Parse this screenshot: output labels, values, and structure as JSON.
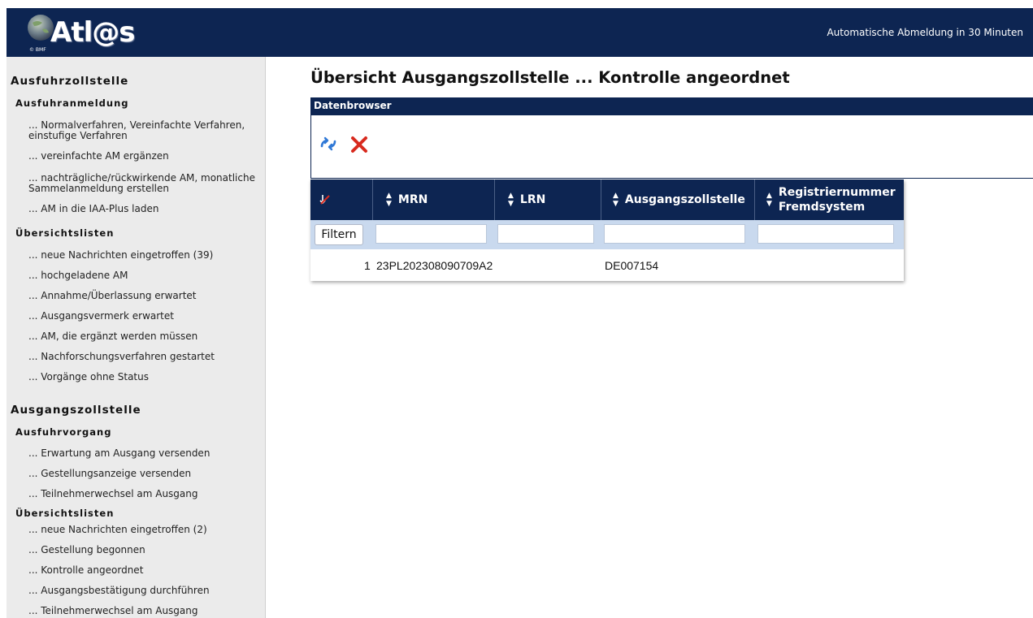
{
  "header": {
    "logo_text": "Atl@s",
    "logo_small": "© BMF",
    "logout_notice": "Automatische Abmeldung in 30 Minuten"
  },
  "sidebar": {
    "sections": [
      {
        "title": "Ausfuhrzollstelle",
        "groups": [
          {
            "title": "Ausfuhranmeldung",
            "items": [
              "... Normalverfahren, Vereinfachte Verfahren, einstufige Verfahren",
              "... vereinfachte AM ergänzen",
              "... nachträgliche/rückwirkende AM, monatliche Sammelanmeldung erstellen",
              "... AM in die IAA-Plus laden"
            ]
          },
          {
            "title": "Übersichtslisten",
            "items": [
              "... neue Nachrichten eingetroffen (39)",
              "... hochgeladene AM",
              "... Annahme/Überlassung erwartet",
              "... Ausgangsvermerk erwartet",
              "... AM, die ergänzt werden müssen",
              "... Nachforschungsverfahren gestartet",
              "... Vorgänge ohne Status"
            ]
          }
        ]
      },
      {
        "title": "Ausgangszollstelle",
        "groups": [
          {
            "title": "Ausfuhrvorgang",
            "items": [
              "... Erwartung am Ausgang versenden",
              "... Gestellungsanzeige versenden",
              "... Teilnehmerwechsel am Ausgang"
            ]
          },
          {
            "title": "Übersichtslisten",
            "items": [
              "... neue Nachrichten eingetroffen (2)",
              "... Gestellung begonnen",
              "... Kontrolle angeordnet",
              "... Ausgangsbestätigung durchführen",
              "... Teilnehmerwechsel am Ausgang"
            ]
          }
        ]
      }
    ]
  },
  "main": {
    "title": "Übersicht Ausgangszollstelle ... Kontrolle angeordnet",
    "browser_title": "Datenbrowser",
    "toolbar": {
      "refresh_icon": "refresh-icon",
      "delete_icon": "delete-icon"
    },
    "grid": {
      "columns": [
        {
          "label": "",
          "icon": "clear-sort-icon"
        },
        {
          "label": "MRN"
        },
        {
          "label": "LRN"
        },
        {
          "label": "Ausgangszollstelle"
        },
        {
          "label": "Registriernummer Fremdsystem"
        }
      ],
      "filter_button": "Filtern",
      "rows": [
        {
          "num": "1",
          "mrn": "23PL202308090709A2",
          "lrn": "",
          "ausgangszollstelle": "DE007154",
          "registriernummer": ""
        }
      ]
    }
  },
  "colors": {
    "header_bg": "#0d2552",
    "sidebar_bg": "#ebebeb",
    "filter_row_bg": "#c9d9ee",
    "delete_icon": "#d82a1e",
    "refresh_icon": "#2f78d6"
  }
}
